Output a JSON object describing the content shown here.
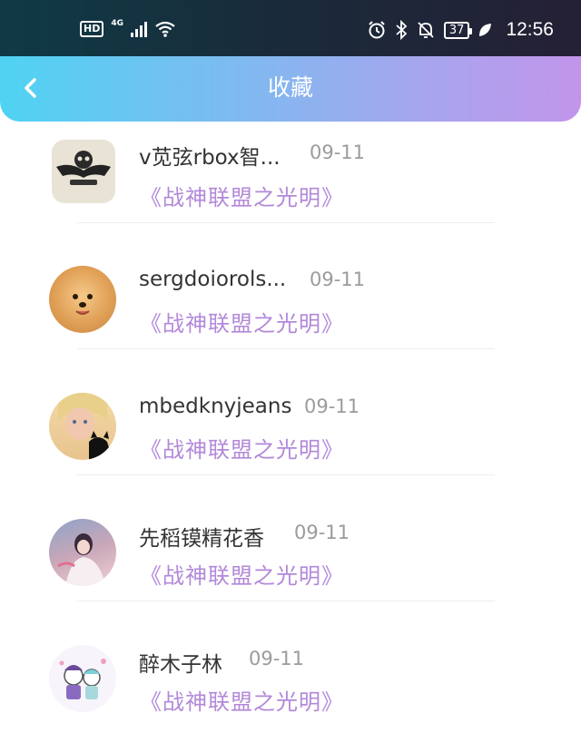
{
  "status_bar": {
    "hd": "HD",
    "network": "4G",
    "battery": "37",
    "time": "12:56"
  },
  "header": {
    "title": "收藏",
    "back_icon": "chevron-left-icon"
  },
  "items": [
    {
      "name": "v苋弦rbox智...",
      "date": "09-11",
      "book": "《战神联盟之光明》",
      "avatar": "skull-avatar"
    },
    {
      "name": "sergdoiorols...",
      "date": "09-11",
      "book": "《战神联盟之光明》",
      "avatar": "pomeranian-avatar"
    },
    {
      "name": "mbedknyjeans",
      "date": "09-11",
      "book": "《战神联盟之光明》",
      "avatar": "girl-with-cat-avatar"
    },
    {
      "name": "先稻镆精花香",
      "date": "09-11",
      "book": "《战神联盟之光明》",
      "avatar": "painted-figure-avatar"
    },
    {
      "name": "醉木子林",
      "date": "09-11",
      "book": "《战神联盟之光明》",
      "avatar": "cartoon-couple-avatar"
    }
  ],
  "colors": {
    "header_start": "#50d3f3",
    "header_end": "#c295ea",
    "book_title": "#b288d9",
    "date": "#9b9b9b"
  }
}
